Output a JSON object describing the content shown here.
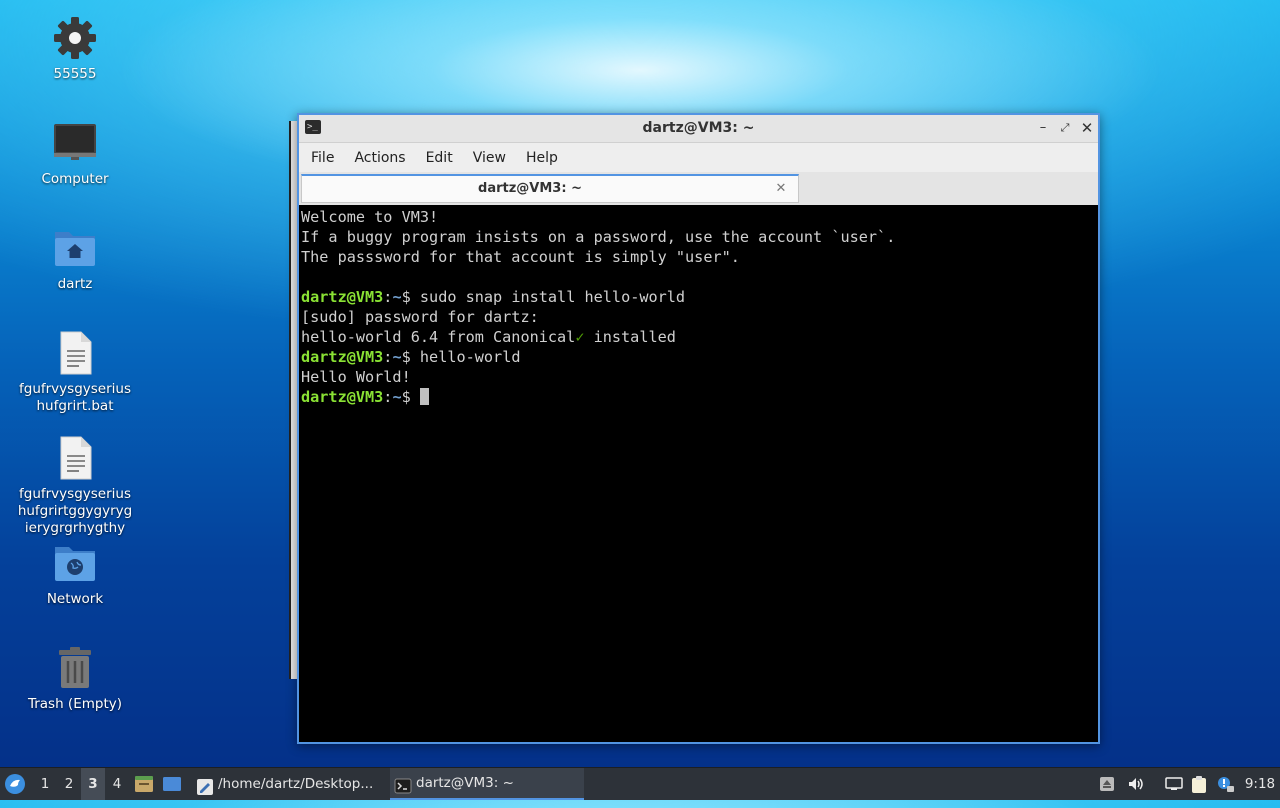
{
  "desktop": {
    "icons": [
      {
        "name": "55555",
        "icon": "gear-icon"
      },
      {
        "name": "Computer",
        "icon": "monitor-icon"
      },
      {
        "name": "dartz",
        "icon": "home-folder-icon"
      },
      {
        "name": "fgufrvysgyserius hufgrirt.bat",
        "icon": "text-file-icon"
      },
      {
        "name": "fgufrvysgyserius hufgrirtggygyryg ierygrgrhygthy",
        "icon": "text-file-icon"
      },
      {
        "name": "Network",
        "icon": "network-folder-icon"
      },
      {
        "name": "Trash (Empty)",
        "icon": "trash-icon"
      }
    ]
  },
  "terminal": {
    "window_title": "dartz@VM3: ~",
    "menu": [
      "File",
      "Actions",
      "Edit",
      "View",
      "Help"
    ],
    "tab_title": "dartz@VM3: ~",
    "lines": {
      "l1": "Welcome to VM3!",
      "l2": "If a buggy program insists on a password, use the account `user`.",
      "l3": "The passsword for that account is simply \"user\".",
      "prompt_user": "dartz@VM3",
      "prompt_sep": ":",
      "prompt_path": "~",
      "prompt_dollar": "$ ",
      "cmd1": "sudo snap install hello-world",
      "l5": "[sudo] password for dartz:",
      "l6a": "hello-world 6.4 from Canonical",
      "l6check": "✓",
      "l6b": " installed",
      "cmd2": "hello-world",
      "l8": "Hello World!"
    }
  },
  "taskbar": {
    "workspaces": [
      "1",
      "2",
      "3",
      "4"
    ],
    "active_workspace": "3",
    "tasks": [
      {
        "label": "/home/dartz/Desktop...",
        "icon": "text-editor-icon"
      },
      {
        "label": "dartz@VM3: ~",
        "icon": "terminal-icon",
        "active": true
      }
    ],
    "clock": "9:18"
  },
  "colors": {
    "accent": "#5294e2",
    "prompt_green": "#8ae234",
    "prompt_blue": "#729fcf",
    "taskbar_bg": "#2d3239"
  }
}
